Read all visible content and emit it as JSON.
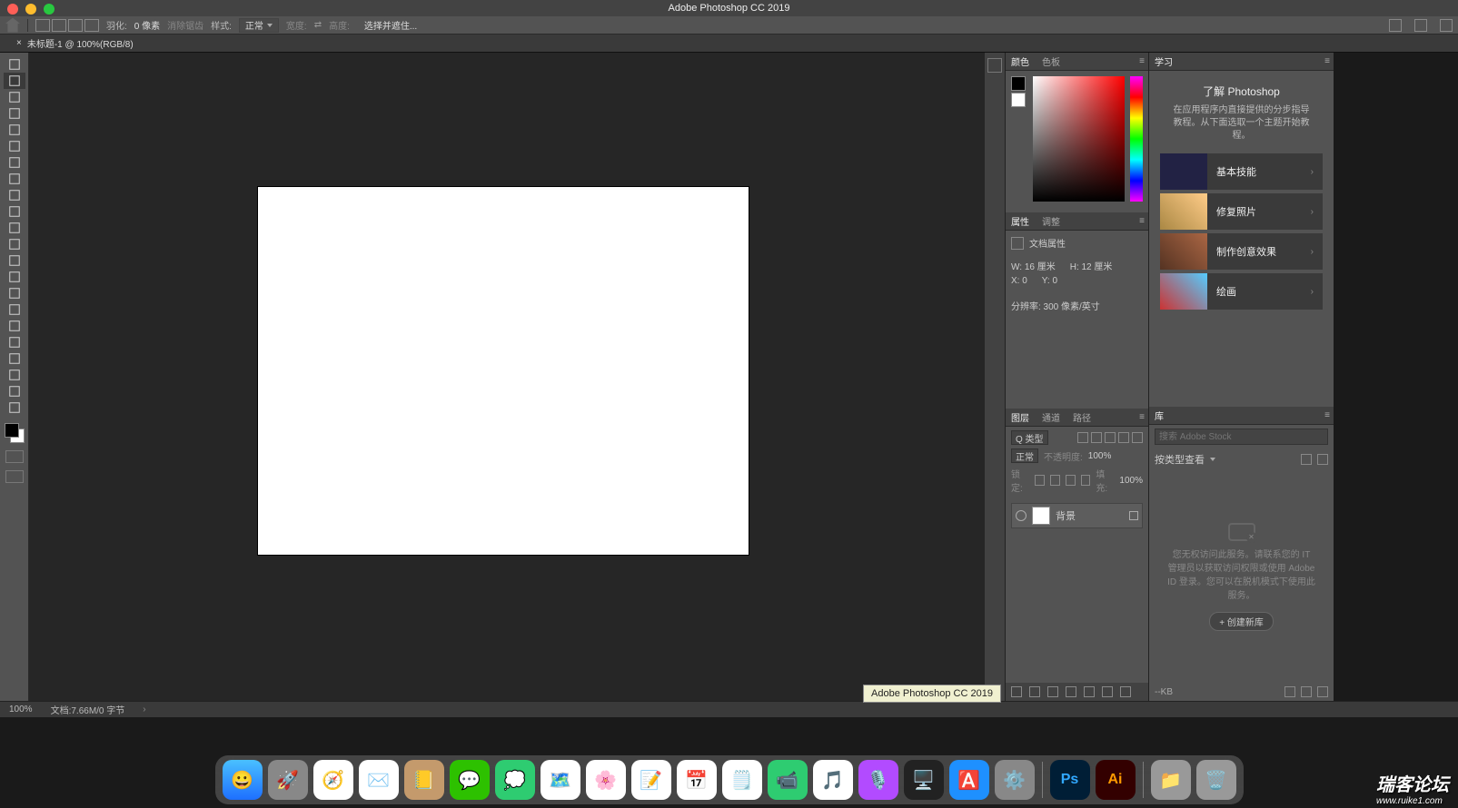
{
  "app_title": "Adobe Photoshop CC 2019",
  "opt": {
    "feather_label": "羽化:",
    "feather_value": "0 像素",
    "antialias": "消除锯齿",
    "style_label": "样式:",
    "style_value": "正常",
    "width_label": "宽度:",
    "height_label": "高度:",
    "select_mask": "选择并遮住..."
  },
  "document_tab": "未标题-1 @ 100%(RGB/8)",
  "status": {
    "zoom": "100%",
    "docinfo": "文档:7.66M/0 字节"
  },
  "tooltip": "Adobe Photoshop CC 2019",
  "panels": {
    "color_tabs": [
      "颜色",
      "色板"
    ],
    "props_tabs": [
      "属性",
      "调整"
    ],
    "props": {
      "doc_label": "文档属性",
      "w": "W: 16 厘米",
      "h": "H: 12 厘米",
      "x": "X: 0",
      "y": "Y: 0",
      "res": "分辨率: 300 像素/英寸"
    },
    "layers_tabs": [
      "图层",
      "通道",
      "路径"
    ],
    "layers": {
      "kind": "Q 类型",
      "blend": "正常",
      "opacity_label": "不透明度:",
      "opacity": "100%",
      "lock_label": "锁定:",
      "fill_label": "填充:",
      "fill": "100%",
      "bg_layer": "背景"
    },
    "learn_tab": "学习",
    "learn": {
      "title": "了解 Photoshop",
      "desc": "在应用程序内直接提供的分步指导教程。从下面选取一个主题开始教程。",
      "cards": [
        "基本技能",
        "修复照片",
        "制作创意效果",
        "绘画"
      ]
    },
    "lib_tab": "库",
    "lib": {
      "search_placeholder": "搜索 Adobe Stock",
      "view": "按类型查看",
      "msg": "您无权访问此服务。请联系您的 IT 管理员以获取访问权限或使用 Adobe ID 登录。您可以在脱机模式下使用此服务。",
      "btn": "+ 创建新库",
      "footer": "--KB"
    }
  },
  "tools": [
    "move",
    "marquee",
    "lasso",
    "quick-select",
    "crop",
    "frame",
    "eyedropper",
    "heal",
    "brush",
    "stamp",
    "history",
    "eraser",
    "gradient",
    "blur",
    "dodge",
    "pen",
    "type",
    "path-select",
    "rectangle",
    "hand",
    "zoom",
    "more"
  ],
  "dock": [
    {
      "name": "finder",
      "bg": "linear-gradient(#4ac0ff,#1e6fff)",
      "emoji": "😀"
    },
    {
      "name": "launchpad",
      "bg": "#888",
      "emoji": "🚀"
    },
    {
      "name": "safari",
      "bg": "#fff",
      "emoji": "🧭"
    },
    {
      "name": "mail",
      "bg": "#fff",
      "emoji": "✉️"
    },
    {
      "name": "contacts",
      "bg": "#c49a6c",
      "emoji": "📒"
    },
    {
      "name": "wechat",
      "bg": "#2dc100",
      "emoji": "💬"
    },
    {
      "name": "messages",
      "bg": "#2ecc71",
      "emoji": "💭"
    },
    {
      "name": "maps",
      "bg": "#fff",
      "emoji": "🗺️"
    },
    {
      "name": "photos",
      "bg": "#fff",
      "emoji": "🌸"
    },
    {
      "name": "reminders",
      "bg": "#fff",
      "emoji": "📝"
    },
    {
      "name": "calendar",
      "bg": "#fff",
      "emoji": "📅"
    },
    {
      "name": "notes",
      "bg": "#fff",
      "emoji": "🗒️"
    },
    {
      "name": "facetime",
      "bg": "#2ecc71",
      "emoji": "📹"
    },
    {
      "name": "music",
      "bg": "#fff",
      "emoji": "🎵"
    },
    {
      "name": "podcasts",
      "bg": "#b24bff",
      "emoji": "🎙️"
    },
    {
      "name": "tv",
      "bg": "#222",
      "emoji": "🖥️"
    },
    {
      "name": "appstore",
      "bg": "#1e90ff",
      "emoji": "🅰️"
    },
    {
      "name": "settings",
      "bg": "#888",
      "emoji": "⚙️"
    }
  ],
  "dock_right": [
    {
      "name": "photoshop",
      "bg": "#001e36",
      "txt": "Ps",
      "color": "#31a8ff"
    },
    {
      "name": "illustrator",
      "bg": "#330000",
      "txt": "Ai",
      "color": "#ff9a00"
    }
  ],
  "watermark": {
    "big": "瑞客论坛",
    "small": "www.ruike1.com"
  }
}
